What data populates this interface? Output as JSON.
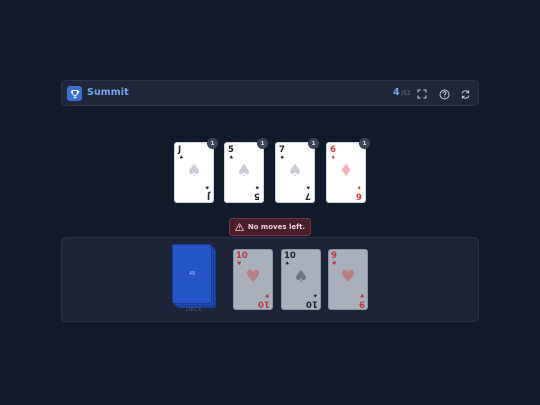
{
  "header": {
    "title": "Summit",
    "score": "4",
    "score_sub": "/52",
    "logo_icon": "trophy-icon",
    "buttons": [
      "fullscreen-icon",
      "help-icon",
      "restart-icon"
    ],
    "accent": "#7aa6ee"
  },
  "peaks": [
    {
      "rank": "J",
      "suit": "♠",
      "color": "black",
      "badge": "1"
    },
    {
      "rank": "5",
      "suit": "♠",
      "color": "black",
      "badge": "1"
    },
    {
      "rank": "7",
      "suit": "♠",
      "color": "black",
      "badge": "1"
    },
    {
      "rank": "6",
      "suit": "♦",
      "color": "red",
      "badge": "1"
    }
  ],
  "status": {
    "text": "No moves left.",
    "icon": "warning-icon"
  },
  "deck": {
    "count": "48",
    "label": "DECK"
  },
  "hand": [
    {
      "rank": "10",
      "suit": "♥",
      "color": "red"
    },
    {
      "rank": "10",
      "suit": "♠",
      "color": "black"
    },
    {
      "rank": "9",
      "suit": "♥",
      "color": "red"
    }
  ]
}
